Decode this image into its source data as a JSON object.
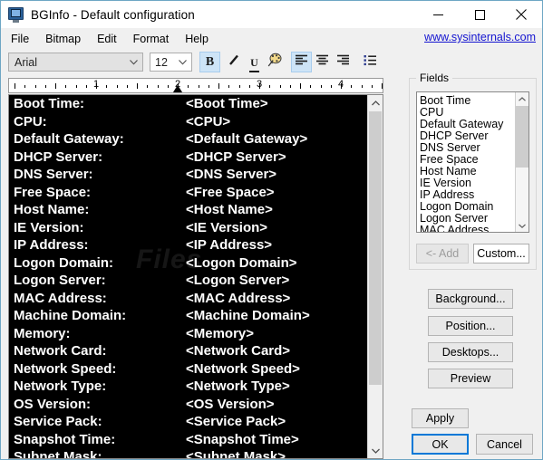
{
  "window": {
    "title": "BGInfo - Default configuration",
    "icon": "monitor-icon",
    "minimize_label": "Minimize",
    "maximize_label": "Maximize",
    "close_label": "Close"
  },
  "menubar": {
    "items": [
      {
        "label": "File"
      },
      {
        "label": "Bitmap"
      },
      {
        "label": "Edit"
      },
      {
        "label": "Format"
      },
      {
        "label": "Help"
      }
    ],
    "link": "www.sysinternals.com",
    "link_color": "#1414d0"
  },
  "toolbar": {
    "font_name": "Arial",
    "font_size": "12",
    "buttons": [
      {
        "name": "bold",
        "glyph": "B",
        "active": true
      },
      {
        "name": "italic",
        "glyph": "╱",
        "active": false
      },
      {
        "name": "underline",
        "glyph": "U",
        "active": false
      },
      {
        "name": "text-color",
        "glyph": "palette",
        "active": false
      },
      {
        "name": "align-left",
        "glyph": "align",
        "active": true
      },
      {
        "name": "align-center",
        "glyph": "align",
        "active": false
      },
      {
        "name": "align-right",
        "glyph": "align",
        "active": false
      },
      {
        "name": "bullet-list",
        "glyph": "list",
        "active": false
      }
    ]
  },
  "ruler": {
    "numbers": [
      "1",
      "2",
      "3",
      "4"
    ],
    "tabstop_position": "2"
  },
  "editor": {
    "watermark": "Files",
    "background_color": "#000000",
    "text_color": "#ffffff",
    "rows": [
      {
        "label": "Boot Time:",
        "value": "<Boot Time>"
      },
      {
        "label": "CPU:",
        "value": "<CPU>"
      },
      {
        "label": "Default Gateway:",
        "value": "<Default Gateway>"
      },
      {
        "label": "DHCP Server:",
        "value": "<DHCP Server>"
      },
      {
        "label": "DNS Server:",
        "value": "<DNS Server>"
      },
      {
        "label": "Free Space:",
        "value": "<Free Space>"
      },
      {
        "label": "Host Name:",
        "value": "<Host Name>"
      },
      {
        "label": "IE Version:",
        "value": "<IE Version>"
      },
      {
        "label": "IP Address:",
        "value": "<IP Address>"
      },
      {
        "label": "Logon Domain:",
        "value": "<Logon Domain>"
      },
      {
        "label": "Logon Server:",
        "value": "<Logon Server>"
      },
      {
        "label": "MAC Address:",
        "value": "<MAC Address>"
      },
      {
        "label": "Machine Domain:",
        "value": "<Machine Domain>"
      },
      {
        "label": "Memory:",
        "value": "<Memory>"
      },
      {
        "label": "Network Card:",
        "value": "<Network Card>"
      },
      {
        "label": "Network Speed:",
        "value": "<Network Speed>"
      },
      {
        "label": "Network Type:",
        "value": "<Network Type>"
      },
      {
        "label": "OS Version:",
        "value": "<OS Version>"
      },
      {
        "label": "Service Pack:",
        "value": "<Service Pack>"
      },
      {
        "label": "Snapshot Time:",
        "value": "<Snapshot Time>"
      },
      {
        "label": "Subnet Mask:",
        "value": "<Subnet Mask>"
      }
    ]
  },
  "fields": {
    "legend": "Fields",
    "items": [
      "Boot Time",
      "CPU",
      "Default Gateway",
      "DHCP Server",
      "DNS Server",
      "Free Space",
      "Host Name",
      "IE Version",
      "IP Address",
      "Logon Domain",
      "Logon Server",
      "MAC Address"
    ],
    "add_button": "<- Add",
    "add_button_enabled": false,
    "custom_button": "Custom..."
  },
  "side_buttons": {
    "background": "Background...",
    "position": "Position...",
    "desktops": "Desktops...",
    "preview": "Preview",
    "apply": "Apply"
  },
  "dialog_buttons": {
    "ok": "OK",
    "cancel": "Cancel",
    "focus_color": "#0078d7"
  }
}
